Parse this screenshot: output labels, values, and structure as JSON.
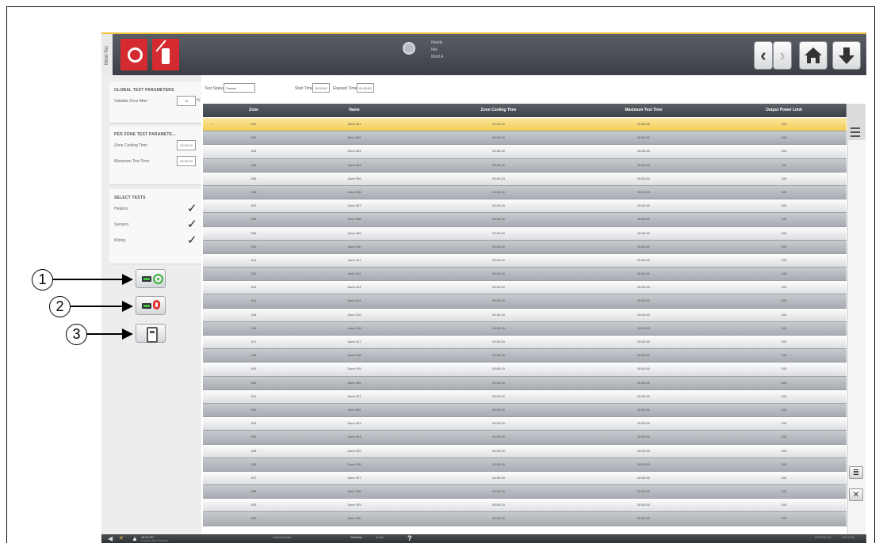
{
  "header": {
    "side_tab": "Mold-Tec",
    "status_lines": [
      "Ready",
      "Idle",
      "Mold A"
    ]
  },
  "global": {
    "title": "GLOBAL TEST PARAMETERS",
    "validate_label": "Validate Zone After",
    "validate_value": "15",
    "validate_unit": "%"
  },
  "per_zone": {
    "title": "PER ZONE TEST PARAMETE...",
    "cooling_label": "Zone Cooling Time",
    "cooling_value": "00:00:10",
    "max_label": "Maximum Test Time",
    "max_value": "00:02:00"
  },
  "select_tests": {
    "title": "SELECT TESTS",
    "items": [
      "Heaters",
      "Sensors",
      "Wiring"
    ]
  },
  "callouts": [
    "1",
    "2",
    "3"
  ],
  "topbar": {
    "status_label": "Test Status",
    "status_value": "Passed",
    "start_label": "Start Time",
    "start_value": "15:20:00",
    "elapsed_label": "Elapsed Time",
    "elapsed_value": "00:15:00"
  },
  "table": {
    "columns": [
      "Zone",
      "Name",
      "Zone Cooling Time",
      "Maximum Test Time",
      "Output Power Limit"
    ],
    "rows": [
      [
        "001",
        "Zone 001",
        "00:00:10",
        "00:02:00",
        "100"
      ],
      [
        "002",
        "Zone 002",
        "00:00:10",
        "00:02:00",
        "100"
      ],
      [
        "003",
        "Zone 003",
        "00:00:10",
        "00:02:00",
        "100"
      ],
      [
        "004",
        "Zone 004",
        "00:00:10",
        "00:02:00",
        "100"
      ],
      [
        "005",
        "Zone 005",
        "00:00:10",
        "00:02:00",
        "100"
      ],
      [
        "006",
        "Zone 006",
        "00:00:10",
        "00:02:00",
        "100"
      ],
      [
        "007",
        "Zone 007",
        "00:00:10",
        "00:02:00",
        "100"
      ],
      [
        "008",
        "Zone 008",
        "00:00:10",
        "00:02:00",
        "100"
      ],
      [
        "009",
        "Zone 009",
        "00:00:10",
        "00:02:00",
        "100"
      ],
      [
        "010",
        "Zone 010",
        "00:00:10",
        "00:02:00",
        "100"
      ],
      [
        "011",
        "Zone 011",
        "00:00:10",
        "00:02:00",
        "100"
      ],
      [
        "012",
        "Zone 012",
        "00:00:10",
        "00:02:00",
        "100"
      ],
      [
        "013",
        "Zone 013",
        "00:00:10",
        "00:02:00",
        "100"
      ],
      [
        "014",
        "Zone 014",
        "00:00:10",
        "00:02:00",
        "100"
      ],
      [
        "015",
        "Zone 015",
        "00:00:10",
        "00:02:00",
        "100"
      ],
      [
        "016",
        "Zone 016",
        "00:00:10",
        "00:02:00",
        "100"
      ],
      [
        "017",
        "Zone 017",
        "00:00:10",
        "00:02:00",
        "100"
      ],
      [
        "018",
        "Zone 018",
        "00:00:10",
        "00:02:00",
        "100"
      ],
      [
        "019",
        "Zone 019",
        "00:00:10",
        "00:02:00",
        "100"
      ],
      [
        "020",
        "Zone 020",
        "00:00:10",
        "00:02:00",
        "100"
      ],
      [
        "021",
        "Zone 021",
        "00:00:10",
        "00:02:00",
        "100"
      ],
      [
        "022",
        "Zone 022",
        "00:00:10",
        "00:02:00",
        "100"
      ],
      [
        "023",
        "Zone 023",
        "00:00:10",
        "00:02:00",
        "100"
      ],
      [
        "024",
        "Zone 024",
        "00:00:10",
        "00:02:00",
        "100"
      ],
      [
        "025",
        "Zone 025",
        "00:00:10",
        "00:02:00",
        "100"
      ],
      [
        "026",
        "Zone 026",
        "00:00:10",
        "00:02:00",
        "100"
      ],
      [
        "027",
        "Zone 027",
        "00:00:10",
        "00:02:00",
        "100"
      ],
      [
        "028",
        "Zone 028",
        "00:00:10",
        "00:02:00",
        "100"
      ],
      [
        "029",
        "Zone 029",
        "00:00:10",
        "00:02:00",
        "100"
      ],
      [
        "030",
        "Zone 030",
        "00:00:10",
        "00:02:00",
        "100"
      ]
    ],
    "selected_index": 0
  },
  "bottom": {
    "alarm_time": "15:21:00",
    "alarm_text": "Controller Alarm Message",
    "user_text": "Administrator",
    "mode_label": "Standby",
    "mode_sub": "Mode",
    "date": "2018-01-10",
    "time": "15:21:30"
  },
  "icons": {
    "nav_back": "chevron-left-icon",
    "nav_forward": "chevron-right-icon",
    "home": "home-icon",
    "download": "download-icon"
  }
}
